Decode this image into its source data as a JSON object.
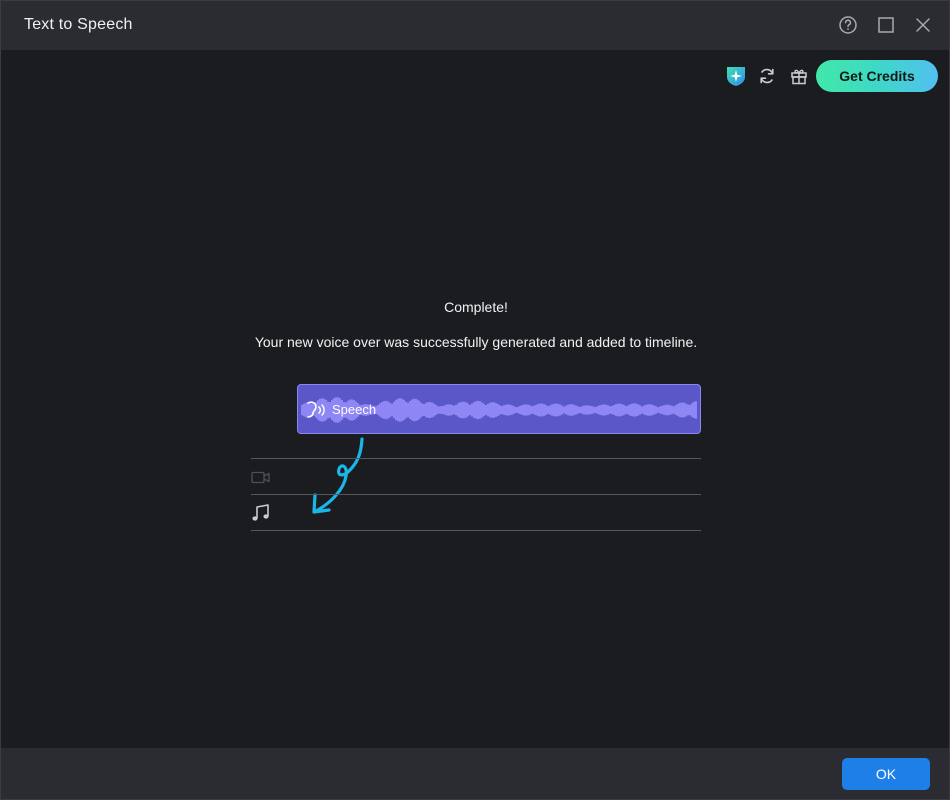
{
  "window": {
    "title": "Text to Speech"
  },
  "titlebar_controls": {
    "help_icon": "help-circle-icon",
    "maximize_icon": "maximize-icon",
    "close_icon": "close-icon"
  },
  "toolbar": {
    "icons": [
      "ai-shield-sparkle-icon",
      "refresh-icon",
      "gift-icon"
    ],
    "get_credits_label": "Get Credits"
  },
  "message": {
    "title": "Complete!",
    "body": "Your new voice over was successfully generated and added to timeline."
  },
  "timeline": {
    "speech_clip_label": "Speech",
    "tracks": [
      "video-track-icon",
      "music-track-icon"
    ]
  },
  "footer": {
    "ok_label": "OK"
  },
  "colors": {
    "accent": "#1f7fe8",
    "clip": "#5a57c9",
    "credits_gradient": [
      "#41e8a8",
      "#52c0f0"
    ],
    "arrow": "#1bb6e8"
  }
}
